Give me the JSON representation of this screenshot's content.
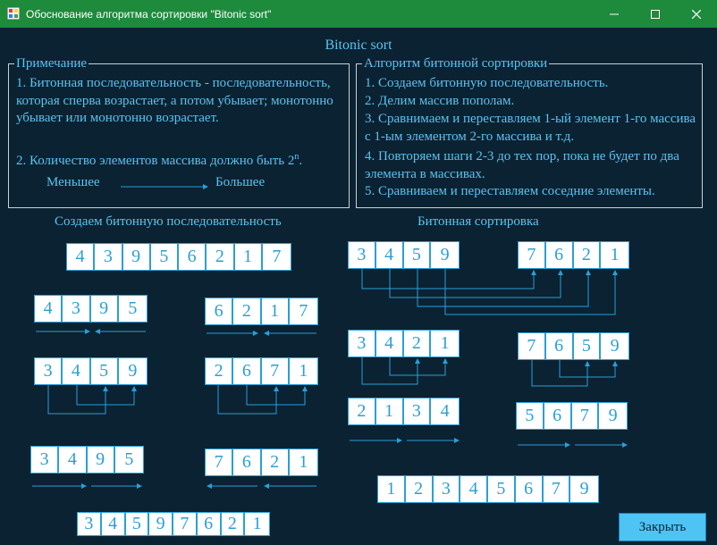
{
  "window": {
    "title": "Обоснование алгоритма сортировки \"Bitonic sort\"",
    "minimize_glyph": "—",
    "maximize_glyph": "☐",
    "close_glyph": "✕"
  },
  "heading": "Bitonic sort",
  "note_box": {
    "legend": "Примечание",
    "item1": "1. Битонная последовательность - последовательность, которая сперва возрастает, а потом убывает; монотонно убывает или монотонно возрастает.",
    "item2_prefix": "2. Количество элементов массива должно быть 2",
    "item2_sup": "n",
    "item2_suffix": ".",
    "less": "Меньшее",
    "greater": "Большее"
  },
  "algo_box": {
    "legend": "Алгоритм битонной сортировки",
    "step1": "1. Создаем битонную последовательность.",
    "step2": "2. Делим массив пополам.",
    "step3": "3. Сравнимаем и переставляем 1-ый элемент 1-го массива с 1-ым элементом 2-го массива и т.д.",
    "step4": "4. Повторяем шаги 2-3 до тех пор, пока не будет по два элемента в массивах.",
    "step5": "5. Сравниваем и переставляем соседние элементы."
  },
  "left_title": "Создаем битонную последовательность",
  "right_title": "Битонная сортировка",
  "arrays": {
    "l_top": [
      "4",
      "3",
      "9",
      "5",
      "6",
      "2",
      "1",
      "7"
    ],
    "l_a1": [
      "4",
      "3",
      "9",
      "5"
    ],
    "l_a2": [
      "6",
      "2",
      "1",
      "7"
    ],
    "l_b1": [
      "3",
      "4",
      "5",
      "9"
    ],
    "l_b2": [
      "2",
      "6",
      "7",
      "1"
    ],
    "l_c1": [
      "3",
      "4",
      "9",
      "5"
    ],
    "l_c2": [
      "7",
      "6",
      "2",
      "1"
    ],
    "l_final": [
      "3",
      "4",
      "5",
      "9",
      "7",
      "6",
      "2",
      "1"
    ],
    "r_a1": [
      "3",
      "4",
      "5",
      "9"
    ],
    "r_a2": [
      "7",
      "6",
      "2",
      "1"
    ],
    "r_b1": [
      "3",
      "4",
      "2",
      "1"
    ],
    "r_b2": [
      "7",
      "6",
      "5",
      "9"
    ],
    "r_c1": [
      "2",
      "1",
      "3",
      "4"
    ],
    "r_c2": [
      "5",
      "6",
      "7",
      "9"
    ],
    "r_final": [
      "1",
      "2",
      "3",
      "4",
      "5",
      "6",
      "7",
      "9"
    ]
  },
  "buttons": {
    "close": "Закрыть"
  }
}
